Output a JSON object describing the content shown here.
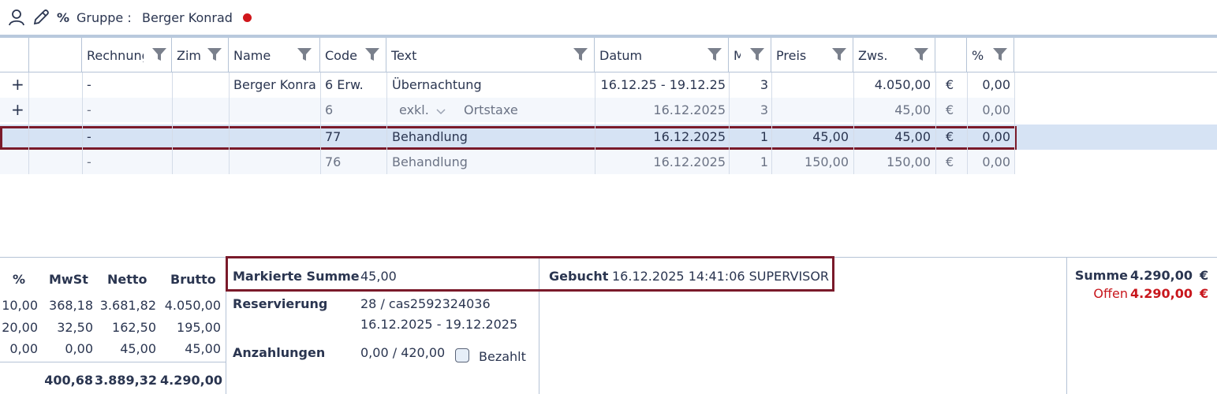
{
  "tab": {
    "percent_symbol": "%",
    "label": "Gruppe :",
    "name": "Berger Konrad",
    "status_color": "#d0161b"
  },
  "grid": {
    "columns": [
      {
        "key": "expand",
        "label": ""
      },
      {
        "key": "blank",
        "label": ""
      },
      {
        "key": "rechnung",
        "label": "Rechnung"
      },
      {
        "key": "zimmer",
        "label": "Zimmer"
      },
      {
        "key": "name",
        "label": "Name"
      },
      {
        "key": "code",
        "label": "Code"
      },
      {
        "key": "text",
        "label": "Text"
      },
      {
        "key": "datum",
        "label": "Datum"
      },
      {
        "key": "menge",
        "label": "Menge"
      },
      {
        "key": "preis",
        "label": "Preis"
      },
      {
        "key": "zws",
        "label": "Zws."
      },
      {
        "key": "currency",
        "label": ""
      },
      {
        "key": "percent",
        "label": "%"
      }
    ],
    "rows": [
      {
        "expand": "+",
        "rechnung": "-",
        "zimmer": "",
        "name": "Berger Konrad",
        "code": "6 Erw.",
        "text": "Übernachtung",
        "text_extra": "",
        "datum": "16.12.25 - 19.12.25",
        "menge": "3",
        "preis": "",
        "zws": "4.050,00",
        "currency": "€",
        "percent": "0,00"
      },
      {
        "expand": "+",
        "rechnung": "-",
        "zimmer": "",
        "name": "",
        "code": "6",
        "text": "exkl.",
        "text_extra": "Ortstaxe",
        "datum": "16.12.2025",
        "menge": "3",
        "preis": "",
        "zws": "45,00",
        "currency": "€",
        "percent": "0,00"
      },
      {
        "expand": "",
        "rechnung": "-",
        "zimmer": "",
        "name": "",
        "code": "77",
        "text": "Behandlung",
        "text_extra": "",
        "datum": "16.12.2025",
        "menge": "1",
        "preis": "45,00",
        "zws": "45,00",
        "currency": "€",
        "percent": "0,00"
      },
      {
        "expand": "",
        "rechnung": "-",
        "zimmer": "",
        "name": "",
        "code": "76",
        "text": "Behandlung",
        "text_extra": "",
        "datum": "16.12.2025",
        "menge": "1",
        "preis": "150,00",
        "zws": "150,00",
        "currency": "€",
        "percent": "0,00"
      }
    ]
  },
  "tax": {
    "headers": [
      "%",
      "MwSt",
      "Netto",
      "Brutto"
    ],
    "rows": [
      [
        "10,00",
        "368,18",
        "3.681,82",
        "4.050,00"
      ],
      [
        "20,00",
        "32,50",
        "162,50",
        "195,00"
      ],
      [
        "0,00",
        "0,00",
        "45,00",
        "45,00"
      ]
    ],
    "totals": [
      "",
      "400,68",
      "3.889,32",
      "4.290,00"
    ]
  },
  "info": {
    "marked_label": "Markierte Summe",
    "marked_value": "45,00",
    "reservation_label": "Reservierung",
    "reservation_id": "28 / cas2592324036",
    "reservation_dates": "16.12.2025  -  19.12.2025",
    "deposit_label": "Anzahlungen",
    "deposit_value": "0,00 / 420,00",
    "paid_label": "Bezahlt"
  },
  "booked": {
    "label": "Gebucht",
    "value": "16.12.2025 14:41:06  SUPERVISOR"
  },
  "summary": {
    "sum_label": "Summe",
    "sum_value": "4.290,00",
    "sum_currency": "€",
    "open_label": "Offen",
    "open_value": "4.290,00",
    "open_currency": "€",
    "open_color": "#c8161c"
  }
}
